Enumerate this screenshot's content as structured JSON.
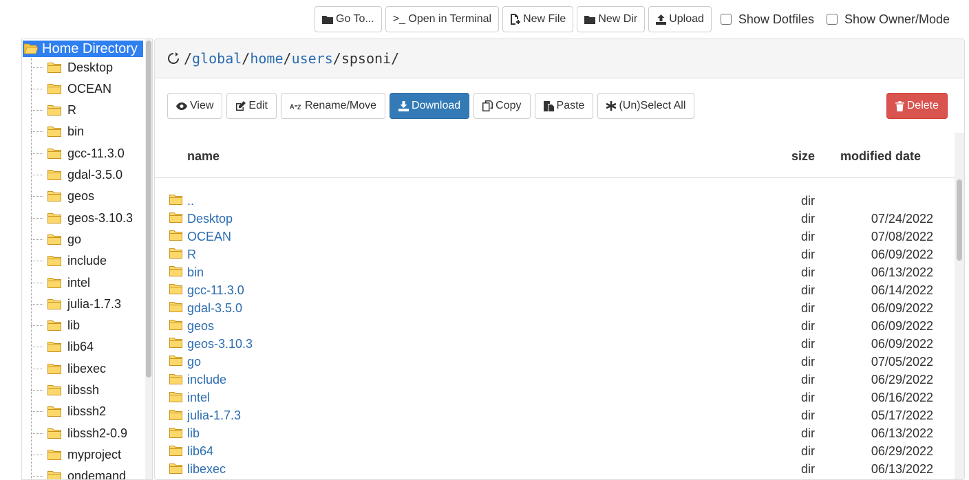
{
  "toolbar": {
    "goto_label": "Go To...",
    "terminal_label": ">_ Open in Terminal",
    "new_file_label": "New File",
    "new_dir_label": "New Dir",
    "upload_label": "Upload",
    "show_dotfiles_label": "Show Dotfiles",
    "show_owner_label": "Show Owner/Mode"
  },
  "tree": {
    "root_label": "Home Directory",
    "items": [
      "Desktop",
      "OCEAN",
      "R",
      "bin",
      "gcc-11.3.0",
      "gdal-3.5.0",
      "geos",
      "geos-3.10.3",
      "go",
      "include",
      "intel",
      "julia-1.7.3",
      "lib",
      "lib64",
      "libexec",
      "libssh",
      "libssh2",
      "libssh2-0.9",
      "myproject",
      "ondemand"
    ]
  },
  "path": {
    "segments": [
      "global",
      "home",
      "users",
      "spsoni"
    ],
    "separator": "/"
  },
  "actions": {
    "view_label": "View",
    "edit_label": "Edit",
    "rename_label": "Rename/Move",
    "download_label": "Download",
    "copy_label": "Copy",
    "paste_label": "Paste",
    "select_all_label": "(Un)Select All",
    "delete_label": "Delete"
  },
  "table": {
    "headers": {
      "name": "name",
      "size": "size",
      "date": "modified date"
    },
    "rows": [
      {
        "name": "..",
        "size": "dir",
        "date": ""
      },
      {
        "name": "Desktop",
        "size": "dir",
        "date": "07/24/2022"
      },
      {
        "name": "OCEAN",
        "size": "dir",
        "date": "07/08/2022"
      },
      {
        "name": "R",
        "size": "dir",
        "date": "06/09/2022"
      },
      {
        "name": "bin",
        "size": "dir",
        "date": "06/13/2022"
      },
      {
        "name": "gcc-11.3.0",
        "size": "dir",
        "date": "06/14/2022"
      },
      {
        "name": "gdal-3.5.0",
        "size": "dir",
        "date": "06/09/2022"
      },
      {
        "name": "geos",
        "size": "dir",
        "date": "06/09/2022"
      },
      {
        "name": "geos-3.10.3",
        "size": "dir",
        "date": "06/09/2022"
      },
      {
        "name": "go",
        "size": "dir",
        "date": "07/05/2022"
      },
      {
        "name": "include",
        "size": "dir",
        "date": "06/29/2022"
      },
      {
        "name": "intel",
        "size": "dir",
        "date": "06/16/2022"
      },
      {
        "name": "julia-1.7.3",
        "size": "dir",
        "date": "05/17/2022"
      },
      {
        "name": "lib",
        "size": "dir",
        "date": "06/13/2022"
      },
      {
        "name": "lib64",
        "size": "dir",
        "date": "06/29/2022"
      },
      {
        "name": "libexec",
        "size": "dir",
        "date": "06/13/2022"
      }
    ]
  },
  "colors": {
    "link": "#2b6cb0",
    "primary": "#337ab7",
    "danger": "#d9534f",
    "tree_selected": "#2e7ff0",
    "folder": "#f4c542"
  }
}
